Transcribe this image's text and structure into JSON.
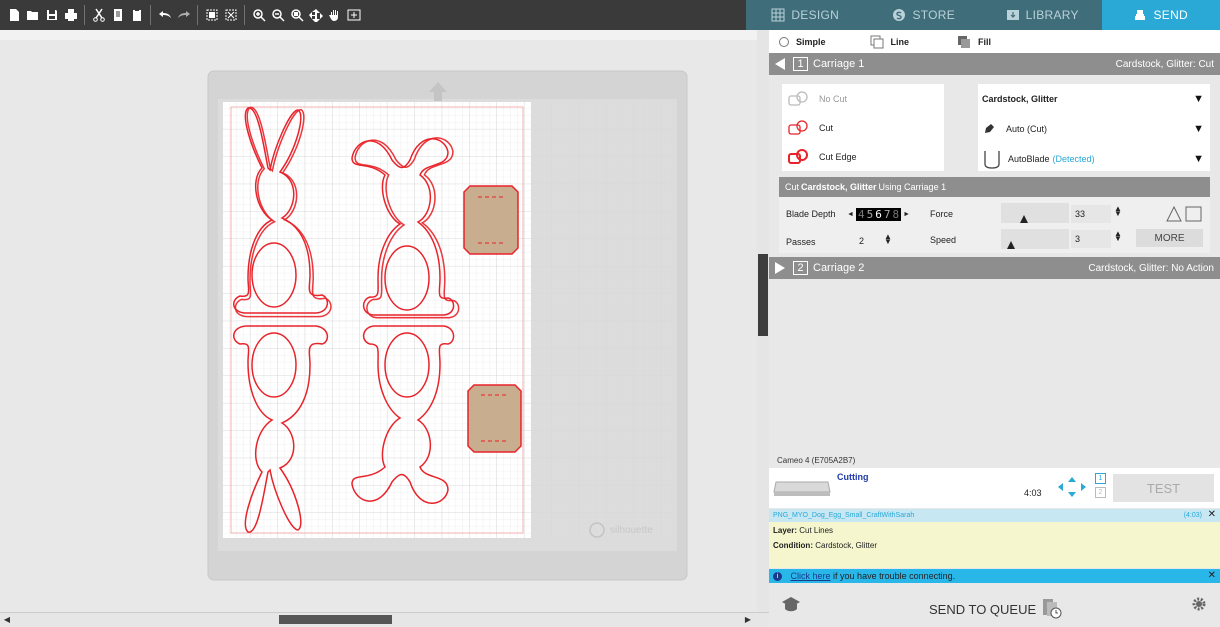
{
  "nav": {
    "tabs": [
      {
        "label": "DESIGN",
        "icon": "design-grid-icon"
      },
      {
        "label": "STORE",
        "icon": "store-s-icon"
      },
      {
        "label": "LIBRARY",
        "icon": "library-icon"
      },
      {
        "label": "SEND",
        "icon": "send-icon"
      }
    ],
    "active": "SEND"
  },
  "toolbar": {
    "icons": [
      "new-doc-icon",
      "open-folder-icon",
      "save-icon",
      "print-icon",
      "cut-icon",
      "copy-icon",
      "paste-icon",
      "undo-icon",
      "redo-icon",
      "select-all-icon",
      "deselect-icon",
      "zoom-in-icon",
      "zoom-out-icon",
      "zoom-select-icon",
      "fit-page-icon",
      "pan-hand-icon",
      "fit-mat-icon"
    ]
  },
  "mat": {
    "watermark": "silhouette"
  },
  "modes": {
    "simple": "Simple",
    "line": "Line",
    "fill": "Fill"
  },
  "carriage1": {
    "number": "1",
    "label": "Carriage 1",
    "summary": "Cardstock, Glitter: Cut"
  },
  "cut_options": {
    "no_cut": "No Cut",
    "cut": "Cut",
    "cut_edge": "Cut Edge"
  },
  "material": {
    "name": "Cardstock, Glitter",
    "tool_mode": "Auto (Cut)",
    "blade": "AutoBlade",
    "blade_status": "(Detected)"
  },
  "cut_header": {
    "prefix": "Cut ",
    "material": "Cardstock, Glitter",
    "suffix": " Using Carriage 1"
  },
  "params": {
    "blade_depth_label": "Blade Depth",
    "blade_depth_digits": [
      "4",
      "5",
      "6",
      "7",
      "8"
    ],
    "force_label": "Force",
    "force_value": "33",
    "force_fraction": 0.32,
    "passes_label": "Passes",
    "passes_value": "2",
    "speed_label": "Speed",
    "speed_value": "3",
    "speed_fraction": 0.1,
    "more_label": "MORE"
  },
  "carriage2": {
    "number": "2",
    "label": "Carriage 2",
    "summary": "Cardstock, Glitter: No Action"
  },
  "machine": {
    "name": "Cameo 4 (E705A2B7)",
    "status": "Cutting",
    "time": "4:03",
    "pages": [
      "1",
      "2"
    ],
    "test_label": "TEST"
  },
  "job": {
    "filename": "PNG_MYO_Dog_Egg_Small_CraftWithSarah",
    "time": "(4:03)"
  },
  "info": {
    "layer_label": "Layer:",
    "layer_value": "Cut Lines",
    "condition_label": "Condition:",
    "condition_value": "Cardstock, Glitter"
  },
  "connection": {
    "link": "Click here",
    "text": " if you have trouble connecting."
  },
  "send_to_queue": "SEND TO QUEUE",
  "colors": {
    "accent": "#2aa8d6",
    "nav_bg": "#3f6d7a",
    "cut_red": "#e8232a",
    "tab_fill": "#c8ad8f"
  }
}
